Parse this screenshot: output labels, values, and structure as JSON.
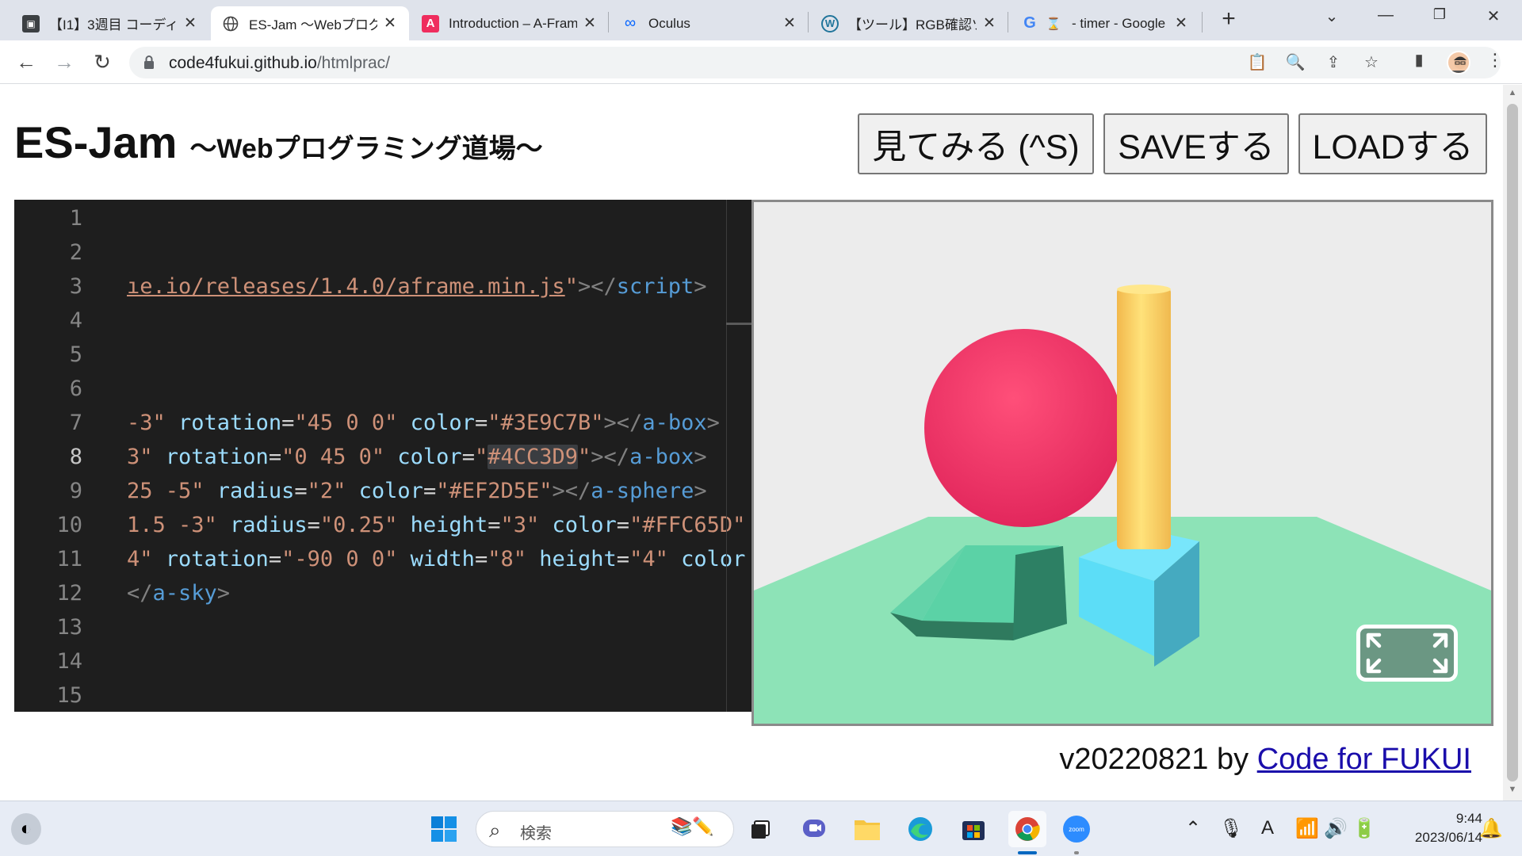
{
  "browser": {
    "tabs": [
      {
        "label": "【I1】3週目 コーディング",
        "icon": "classroom-icon",
        "active": false
      },
      {
        "label": "ES-Jam 〜Webプログラミング道場〜",
        "icon": "globe-icon",
        "active": true
      },
      {
        "label": "Introduction – A-Frame",
        "icon": "aframe-icon",
        "active": false
      },
      {
        "label": "Oculus",
        "icon": "meta-icon",
        "active": false
      },
      {
        "label": "【ツール】RGB確認ツール",
        "icon": "wordpress-icon",
        "active": false
      },
      {
        "label": "- timer - Google",
        "icon": "google-icon",
        "active": false
      }
    ],
    "url_host": "code4fukui.github.io",
    "url_path": "/htmlprac/"
  },
  "page": {
    "title": "ES-Jam",
    "subtitle": "〜Webプログラミング道場〜",
    "buttons": {
      "view": "見てみる (^S)",
      "save": "SAVEする",
      "load": "LOADする"
    },
    "footer_version": "v20220821 by ",
    "footer_link": "Code for FUKUI"
  },
  "editor": {
    "line_numbers": [
      "1",
      "2",
      "3",
      "4",
      "5",
      "6",
      "7",
      "8",
      "9",
      "10",
      "11",
      "12",
      "13",
      "14",
      "15"
    ],
    "current_line": 8,
    "lines": [
      [],
      [],
      [
        {
          "t": "ıe.io/releases/1.4.0/aframe.min.js",
          "c": "k-link"
        },
        {
          "t": "\"",
          "c": "k-str"
        },
        {
          "t": "></",
          "c": "k-punc"
        },
        {
          "t": "script",
          "c": "k-tag"
        },
        {
          "t": ">",
          "c": "k-punc"
        }
      ],
      [],
      [],
      [],
      [
        {
          "t": "-3\"",
          "c": "k-str"
        },
        {
          "t": " rotation",
          "c": "k-attr"
        },
        {
          "t": "=",
          "c": ""
        },
        {
          "t": "\"45 0 0\"",
          "c": "k-str"
        },
        {
          "t": " color",
          "c": "k-attr"
        },
        {
          "t": "=",
          "c": ""
        },
        {
          "t": "\"#3E9C7B\"",
          "c": "k-str"
        },
        {
          "t": "></",
          "c": "k-punc"
        },
        {
          "t": "a-box",
          "c": "k-tag"
        },
        {
          "t": ">",
          "c": "k-punc"
        }
      ],
      [
        {
          "t": "3\"",
          "c": "k-str"
        },
        {
          "t": " rotation",
          "c": "k-attr"
        },
        {
          "t": "=",
          "c": ""
        },
        {
          "t": "\"0 45 0\"",
          "c": "k-str"
        },
        {
          "t": " color",
          "c": "k-attr"
        },
        {
          "t": "=",
          "c": ""
        },
        {
          "t": "\"",
          "c": "k-str"
        },
        {
          "t": "#4CC3D9",
          "c": "k-str hl"
        },
        {
          "t": "\"",
          "c": "k-str"
        },
        {
          "t": "></",
          "c": "k-punc"
        },
        {
          "t": "a-box",
          "c": "k-tag"
        },
        {
          "t": ">",
          "c": "k-punc"
        }
      ],
      [
        {
          "t": "25 -5\"",
          "c": "k-str"
        },
        {
          "t": " radius",
          "c": "k-attr"
        },
        {
          "t": "=",
          "c": ""
        },
        {
          "t": "\"2\"",
          "c": "k-str"
        },
        {
          "t": " color",
          "c": "k-attr"
        },
        {
          "t": "=",
          "c": ""
        },
        {
          "t": "\"#EF2D5E\"",
          "c": "k-str"
        },
        {
          "t": "></",
          "c": "k-punc"
        },
        {
          "t": "a-sphere",
          "c": "k-tag"
        },
        {
          "t": ">",
          "c": "k-punc"
        }
      ],
      [
        {
          "t": "1.5 -3\"",
          "c": "k-str"
        },
        {
          "t": " radius",
          "c": "k-attr"
        },
        {
          "t": "=",
          "c": ""
        },
        {
          "t": "\"0.25\"",
          "c": "k-str"
        },
        {
          "t": " height",
          "c": "k-attr"
        },
        {
          "t": "=",
          "c": ""
        },
        {
          "t": "\"3\"",
          "c": "k-str"
        },
        {
          "t": " color",
          "c": "k-attr"
        },
        {
          "t": "=",
          "c": ""
        },
        {
          "t": "\"#FFC65D\"",
          "c": "k-str"
        }
      ],
      [
        {
          "t": "4\"",
          "c": "k-str"
        },
        {
          "t": " rotation",
          "c": "k-attr"
        },
        {
          "t": "=",
          "c": ""
        },
        {
          "t": "\"-90 0 0\"",
          "c": "k-str"
        },
        {
          "t": " width",
          "c": "k-attr"
        },
        {
          "t": "=",
          "c": ""
        },
        {
          "t": "\"8\"",
          "c": "k-str"
        },
        {
          "t": " height",
          "c": "k-attr"
        },
        {
          "t": "=",
          "c": ""
        },
        {
          "t": "\"4\"",
          "c": "k-str"
        },
        {
          "t": " color",
          "c": "k-attr"
        }
      ],
      [
        {
          "t": "</",
          "c": "k-punc"
        },
        {
          "t": "a-sky",
          "c": "k-tag"
        },
        {
          "t": ">",
          "c": "k-punc"
        }
      ],
      [],
      [],
      []
    ]
  },
  "scene_colors": {
    "background": "#ECECEC",
    "plane": "#8DE3B7",
    "sphere": "#EF2D5E",
    "box_green": "#5BD2A6",
    "box_blue": "#5CDDF7",
    "cylinder": "#FFC65D"
  },
  "taskbar": {
    "search_placeholder": "検索",
    "time": "9:44",
    "date": "2023/06/14",
    "apps": [
      "windows-start-icon",
      "task-view-icon",
      "teams-chat-icon",
      "file-explorer-icon",
      "edge-icon",
      "store-icon",
      "chrome-icon",
      "zoom-icon"
    ]
  }
}
